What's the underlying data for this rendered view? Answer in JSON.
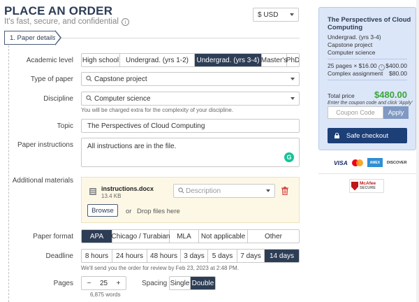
{
  "header": {
    "title": "PLACE AN ORDER",
    "subtitle": "It's fast, secure, and confidential",
    "currency": "$ USD"
  },
  "step": {
    "label": "1.  Paper details"
  },
  "form": {
    "academic_level": {
      "label": "Academic level",
      "options": [
        "High school",
        "Undergrad. (yrs 1-2)",
        "Undergrad. (yrs 3-4)",
        "Master's",
        "PhD"
      ],
      "selected": "Undergrad. (yrs 3-4)"
    },
    "type_of_paper": {
      "label": "Type of paper",
      "value": "Capstone project"
    },
    "discipline": {
      "label": "Discipline",
      "value": "Computer science",
      "note": "You will be charged extra for the complexity of your discipline."
    },
    "topic": {
      "label": "Topic",
      "value": "The Perspectives of Cloud Computing"
    },
    "instructions": {
      "label": "Paper instructions",
      "value": "All instructions are in the file."
    },
    "materials": {
      "label": "Additional materials",
      "file_name": "instructions.docx",
      "file_size": "13.4 KB",
      "description_placeholder": "Description",
      "browse": "Browse",
      "or": "or",
      "drop": "Drop files here"
    },
    "paper_format": {
      "label": "Paper format",
      "options": [
        "APA",
        "Chicago / Turabian",
        "MLA",
        "Not applicable",
        "Other"
      ],
      "selected": "APA"
    },
    "deadline": {
      "label": "Deadline",
      "options": [
        "8 hours",
        "24 hours",
        "48 hours",
        "3 days",
        "5 days",
        "7 days",
        "14 days"
      ],
      "selected": "14 days",
      "note": "We'll send you the order for review by Feb 23, 2023 at 2:48 PM."
    },
    "pages": {
      "label": "Pages",
      "minus": "−",
      "value": "25",
      "plus": "+",
      "words": "6,875 words"
    },
    "spacing": {
      "label": "Spacing",
      "options": [
        "Single",
        "Double"
      ],
      "selected": "Double"
    }
  },
  "summary": {
    "title": "The Perspectives of Cloud Computing",
    "level": "Undergrad. (yrs 3-4)",
    "type": "Capstone project",
    "discipline": "Computer science",
    "pages_line": "25 pages × $16.00",
    "pages_price": "$400.00",
    "complex_label": "Complex assignment",
    "complex_price": "$80.00",
    "total_label": "Total price",
    "total": "$480.00",
    "coupon_note": "Enter the coupon code and click 'Apply'",
    "coupon_placeholder": "Coupon Code",
    "apply": "Apply",
    "checkout": "Safe checkout"
  },
  "badges": {
    "visa": "VISA",
    "amex": "AMEX",
    "discover": "DISCOVER",
    "mcafee": "McAfee",
    "secure": "SECURE"
  },
  "colors": {
    "primary": "#2d3d55",
    "sidebar_bg": "#dbe6f8",
    "checkout": "#1d3f78",
    "total": "#3aa63a",
    "upload_bg": "#fdf8e6"
  }
}
